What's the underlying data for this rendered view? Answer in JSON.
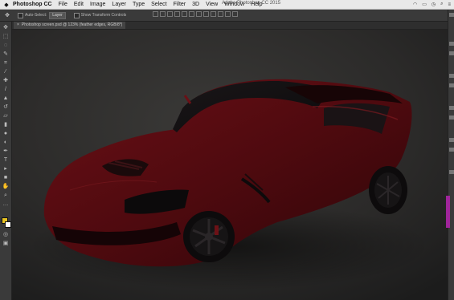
{
  "menubar": {
    "apple_icon": "apple-icon",
    "app_name": "Photoshop CC",
    "items": [
      "File",
      "Edit",
      "Image",
      "Layer",
      "Type",
      "Select",
      "Filter",
      "3D",
      "View",
      "Window",
      "Help"
    ],
    "window_title": "Adobe Photoshop CC 2015",
    "status_icons": [
      "wifi-icon",
      "battery-icon",
      "clock-icon",
      "search-icon",
      "menu-icon"
    ]
  },
  "options_bar": {
    "tool_icon": "move-tool-icon",
    "auto_select_label": "Auto-Select:",
    "auto_select_value": "Layer",
    "show_transform_label": "Show Transform Controls"
  },
  "document": {
    "tab_title": "Photoshop screen.psd @ 123% (feather edges, RGB/8*)",
    "close_icon": "close-icon"
  },
  "tools": [
    "move-icon",
    "marquee-icon",
    "lasso-icon",
    "quick-select-icon",
    "crop-icon",
    "eyedropper-icon",
    "healing-brush-icon",
    "brush-icon",
    "clone-stamp-icon",
    "history-brush-icon",
    "eraser-icon",
    "gradient-icon",
    "blur-icon",
    "dodge-icon",
    "pen-icon",
    "type-icon",
    "path-select-icon",
    "shape-icon",
    "hand-icon",
    "zoom-icon",
    "more-tools-icon"
  ],
  "colors": {
    "foreground": "#e8c322",
    "background": "#ffffff",
    "car_body": "#5a0b10",
    "backdrop": "#2b2a29"
  }
}
